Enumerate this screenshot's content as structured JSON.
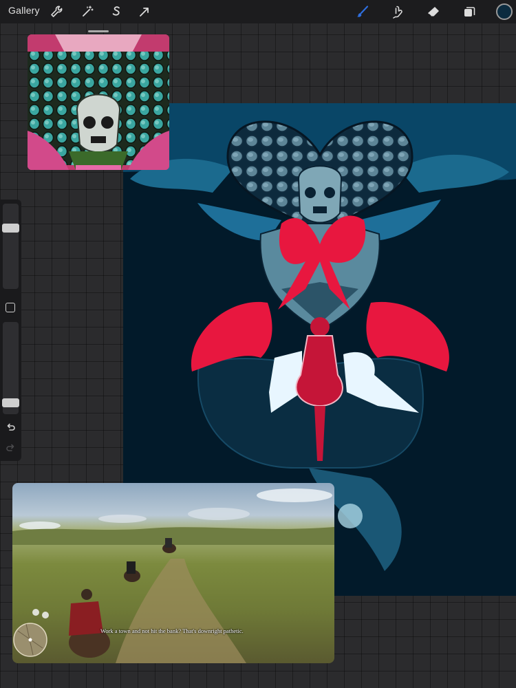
{
  "toolbar": {
    "gallery_label": "Gallery",
    "left_tools": [
      {
        "name": "actions",
        "icon": "wrench-icon"
      },
      {
        "name": "adjustments",
        "icon": "magic-wand-icon"
      },
      {
        "name": "selection",
        "icon": "selection-s-icon"
      },
      {
        "name": "transform",
        "icon": "arrow-cursor-icon"
      }
    ],
    "right_tools": [
      {
        "name": "brush",
        "icon": "brush-icon",
        "active": true
      },
      {
        "name": "smudge",
        "icon": "smudge-icon"
      },
      {
        "name": "eraser",
        "icon": "eraser-icon"
      },
      {
        "name": "layers",
        "icon": "layers-icon"
      }
    ],
    "current_color": "#0b2b3f",
    "active_color": "#2f6fe0"
  },
  "sidebar": {
    "brush_size_level": 0.75,
    "opacity_level": 0.07,
    "icons": [
      "modify-square-icon",
      "undo-icon",
      "redo-icon"
    ]
  },
  "canvas": {
    "background": "#021a2a",
    "accent_red": "#e8173f",
    "accent_teal": "#1b6a8e"
  },
  "video": {
    "subtitle": "Work a town and not hit the bank? That's downright pathetic."
  }
}
